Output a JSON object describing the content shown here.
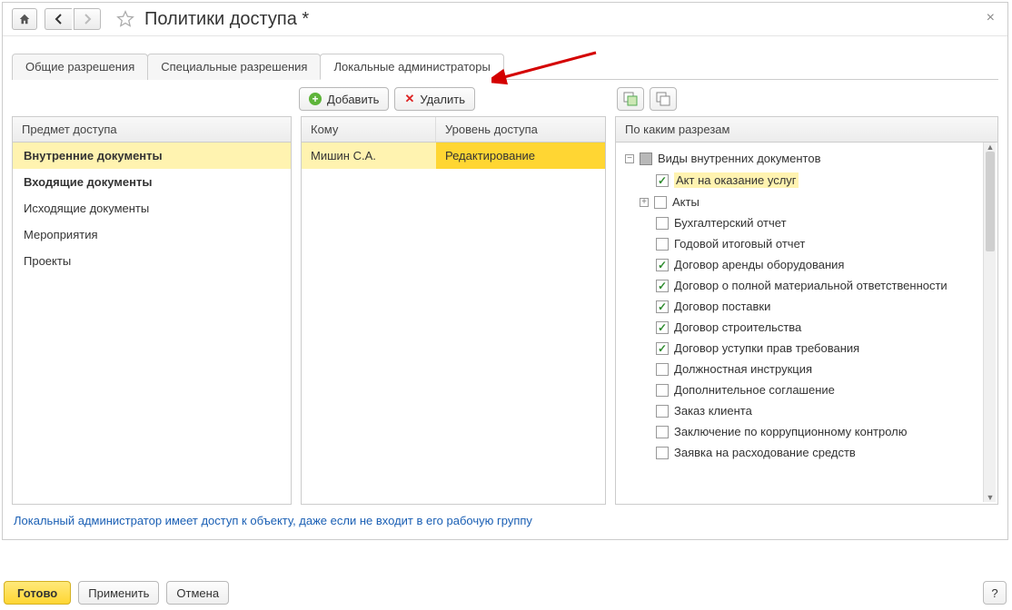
{
  "title": "Политики доступа *",
  "tabs": {
    "general": "Общие разрешения",
    "special": "Специальные разрешения",
    "local_admins": "Локальные администраторы"
  },
  "toolbar": {
    "add": "Добавить",
    "delete": "Удалить"
  },
  "left_panel": {
    "header": "Предмет доступа",
    "items": [
      {
        "label": "Внутренние документы",
        "bold": true,
        "selected": true
      },
      {
        "label": "Входящие документы",
        "bold": true
      },
      {
        "label": "Исходящие документы"
      },
      {
        "label": "Мероприятия"
      },
      {
        "label": "Проекты"
      }
    ]
  },
  "mid_panel": {
    "header_who": "Кому",
    "header_level": "Уровень доступа",
    "rows": [
      {
        "who": "Мишин С.А.",
        "level": "Редактирование",
        "selected": true
      }
    ]
  },
  "right_panel": {
    "header": "По каким разрезам",
    "root": "Виды внутренних документов",
    "items": [
      {
        "label": "Акт на оказание услуг",
        "checked": true,
        "hl": true
      },
      {
        "label": "Акты",
        "checked": false,
        "expandable": true
      },
      {
        "label": "Бухгалтерский отчет",
        "checked": false
      },
      {
        "label": "Годовой итоговый отчет",
        "checked": false
      },
      {
        "label": "Договор аренды оборудования",
        "checked": true
      },
      {
        "label": "Договор о полной материальной ответственности",
        "checked": true
      },
      {
        "label": "Договор поставки",
        "checked": true
      },
      {
        "label": "Договор строительства",
        "checked": true
      },
      {
        "label": "Договор уступки прав требования",
        "checked": true
      },
      {
        "label": "Должностная инструкция",
        "checked": false
      },
      {
        "label": "Дополнительное соглашение",
        "checked": false
      },
      {
        "label": "Заказ клиента",
        "checked": false
      },
      {
        "label": "Заключение по коррупционному контролю",
        "checked": false
      },
      {
        "label": "Заявка на расходование средств",
        "checked": false
      }
    ]
  },
  "hint": "Локальный администратор имеет доступ к объекту, даже если не входит в его рабочую группу",
  "footer": {
    "ready": "Готово",
    "apply": "Применить",
    "cancel": "Отмена",
    "help": "?"
  }
}
